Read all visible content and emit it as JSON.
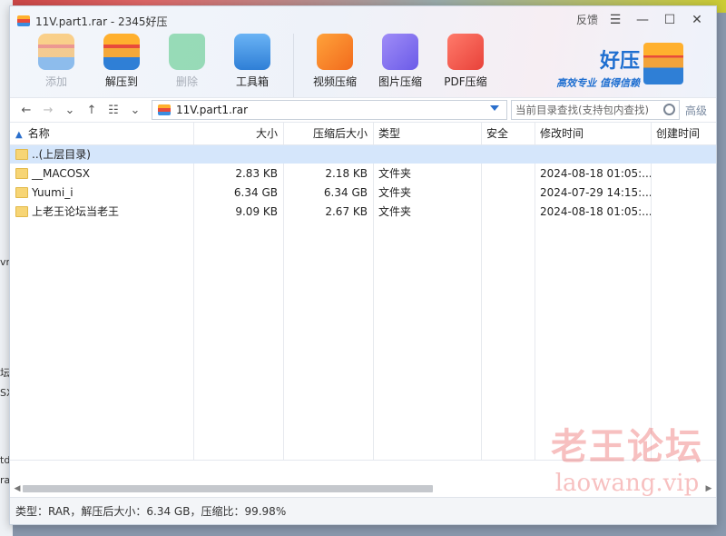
{
  "window": {
    "title": "11V.part1.rar - 2345好压",
    "feedback_label": "反馈"
  },
  "toolbar": {
    "add": "添加",
    "extract": "解压到",
    "delete": "删除",
    "toolbox": "工具箱",
    "video": "视频压缩",
    "image": "图片压缩",
    "pdf": "PDF压缩"
  },
  "brand": {
    "name": "好压",
    "slogan": "高效专业 值得信赖"
  },
  "navbar": {
    "path": "11V.part1.rar",
    "search_placeholder": "当前目录查找(支持包内查找)",
    "advanced": "高级"
  },
  "table": {
    "headers": {
      "name": "名称",
      "size": "大小",
      "packed": "压缩后大小",
      "type": "类型",
      "security": "安全",
      "modified": "修改时间",
      "created": "创建时间"
    },
    "rows": [
      {
        "name": "..(上层目录)",
        "size": "",
        "packed": "",
        "type": "",
        "modified": ""
      },
      {
        "name": "__MACOSX",
        "size": "2.83 KB",
        "packed": "2.18 KB",
        "type": "文件夹",
        "modified": "2024-08-18 01:05:..."
      },
      {
        "name": "Yuumi_i",
        "size": "6.34 GB",
        "packed": "6.34 GB",
        "type": "文件夹",
        "modified": "2024-07-29 14:15:..."
      },
      {
        "name": "上老王论坛当老王",
        "size": "9.09 KB",
        "packed": "2.67 KB",
        "type": "文件夹",
        "modified": "2024-08-18 01:05:..."
      }
    ]
  },
  "status": "类型：RAR，解压后大小：6.34 GB，压缩比：99.98%",
  "watermark": {
    "line1": "老王论坛",
    "line2": "laowang.vip"
  },
  "desktop_fragments": [
    "vn",
    "坛",
    "SX",
    "td",
    "rar"
  ],
  "colors": {
    "accent": "#1f6fd0",
    "selection": "#d5e6fb"
  }
}
